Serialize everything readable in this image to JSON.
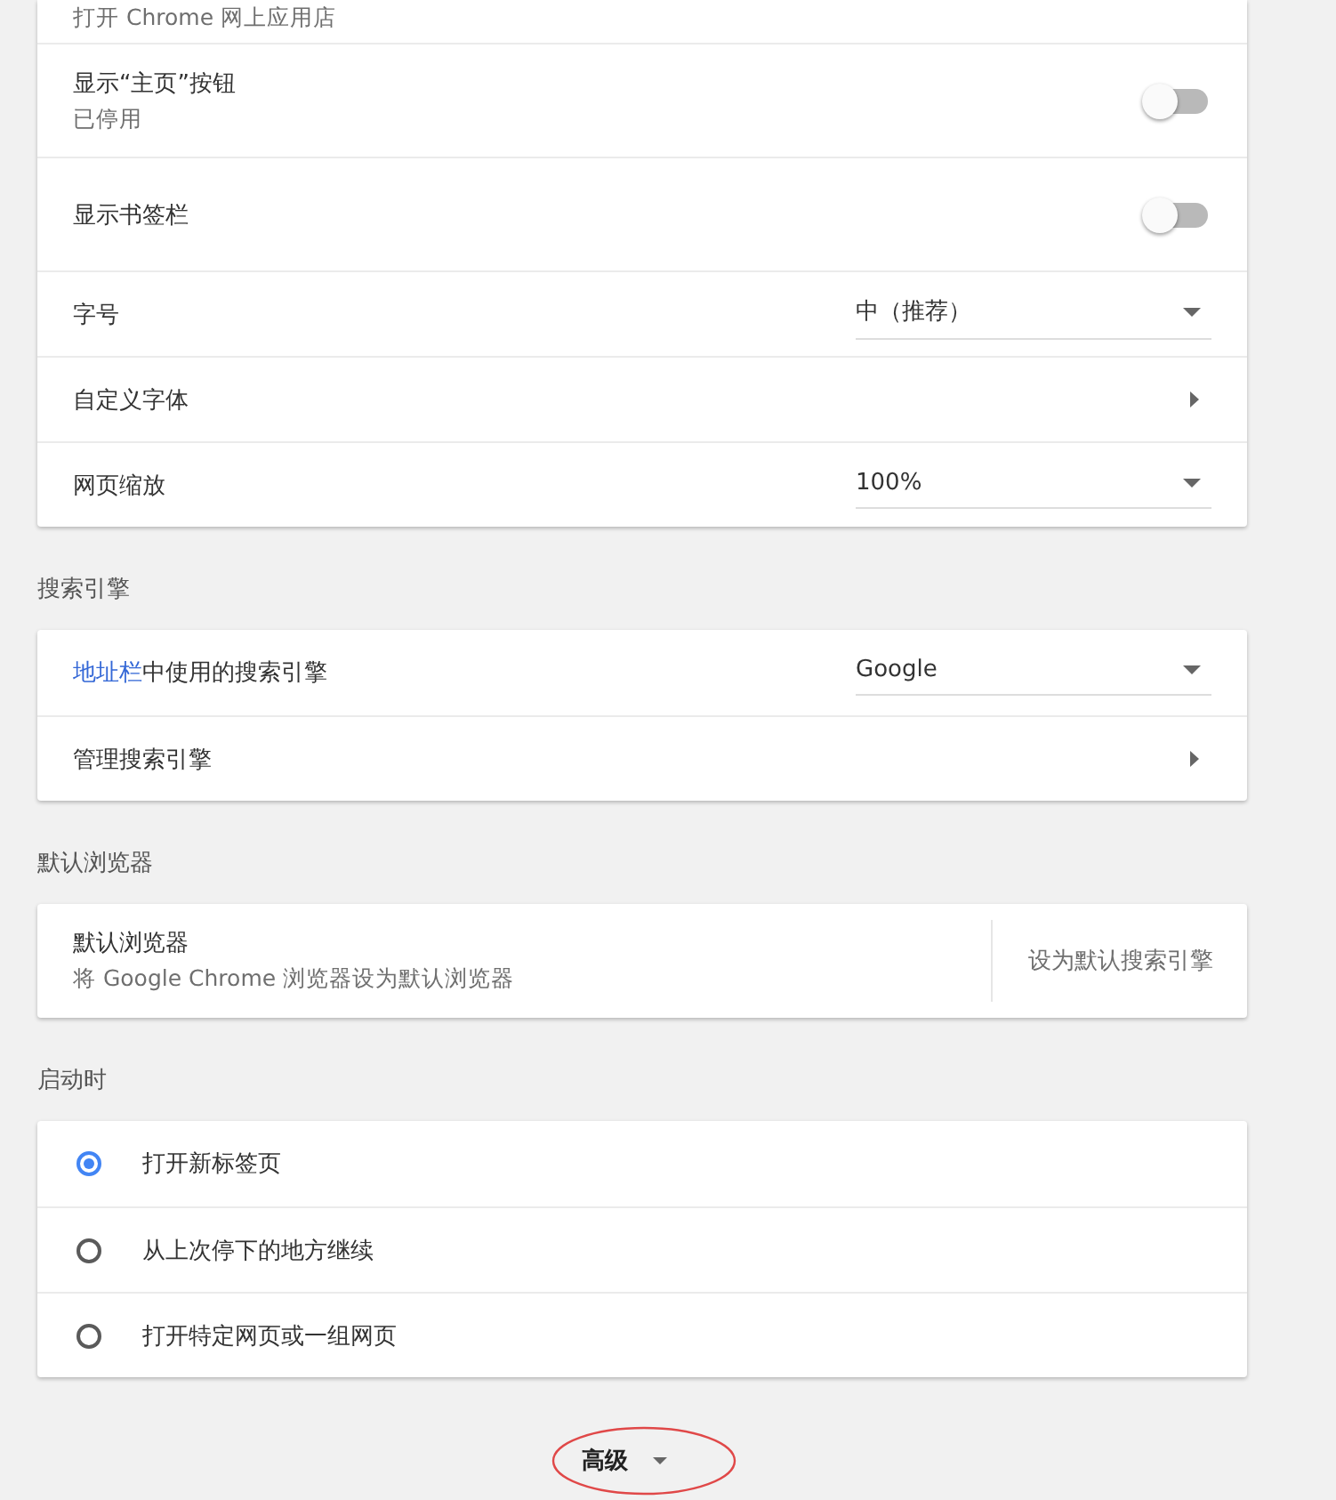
{
  "top_card": {
    "rows": [
      {
        "kind": "plain",
        "label": "打开 Chrome 网上应用店"
      },
      {
        "kind": "toggle",
        "label": "显示“主页”按钮",
        "sublabel": "已停用",
        "on": false
      },
      {
        "kind": "toggle",
        "label": "显示书签栏",
        "on": false
      },
      {
        "kind": "select",
        "label": "字号",
        "value": "中（推荐）"
      },
      {
        "kind": "submenu",
        "label": "自定义字体"
      },
      {
        "kind": "select",
        "label": "网页缩放",
        "value": "100%"
      }
    ]
  },
  "sections": [
    {
      "heading": "搜索引擎",
      "rows": [
        {
          "kind": "select",
          "link": "地址栏",
          "label": "中使用的搜索引擎",
          "value": "Google"
        },
        {
          "kind": "submenu",
          "label": "管理搜索引擎"
        }
      ]
    },
    {
      "heading": "默认浏览器",
      "rows": [
        {
          "kind": "action",
          "label": "默认浏览器",
          "sublabel": "将 Google Chrome 浏览器设为默认浏览器",
          "action": "设为默认搜索引擎"
        }
      ]
    },
    {
      "heading": "启动时",
      "rows": [
        {
          "kind": "radio",
          "label": "打开新标签页",
          "selected": true
        },
        {
          "kind": "radio",
          "label": "从上次停下的地方继续",
          "selected": false
        },
        {
          "kind": "radio",
          "label": "打开特定网页或一组网页",
          "selected": false
        }
      ]
    }
  ],
  "advanced": {
    "label": "高级",
    "circled": true
  }
}
